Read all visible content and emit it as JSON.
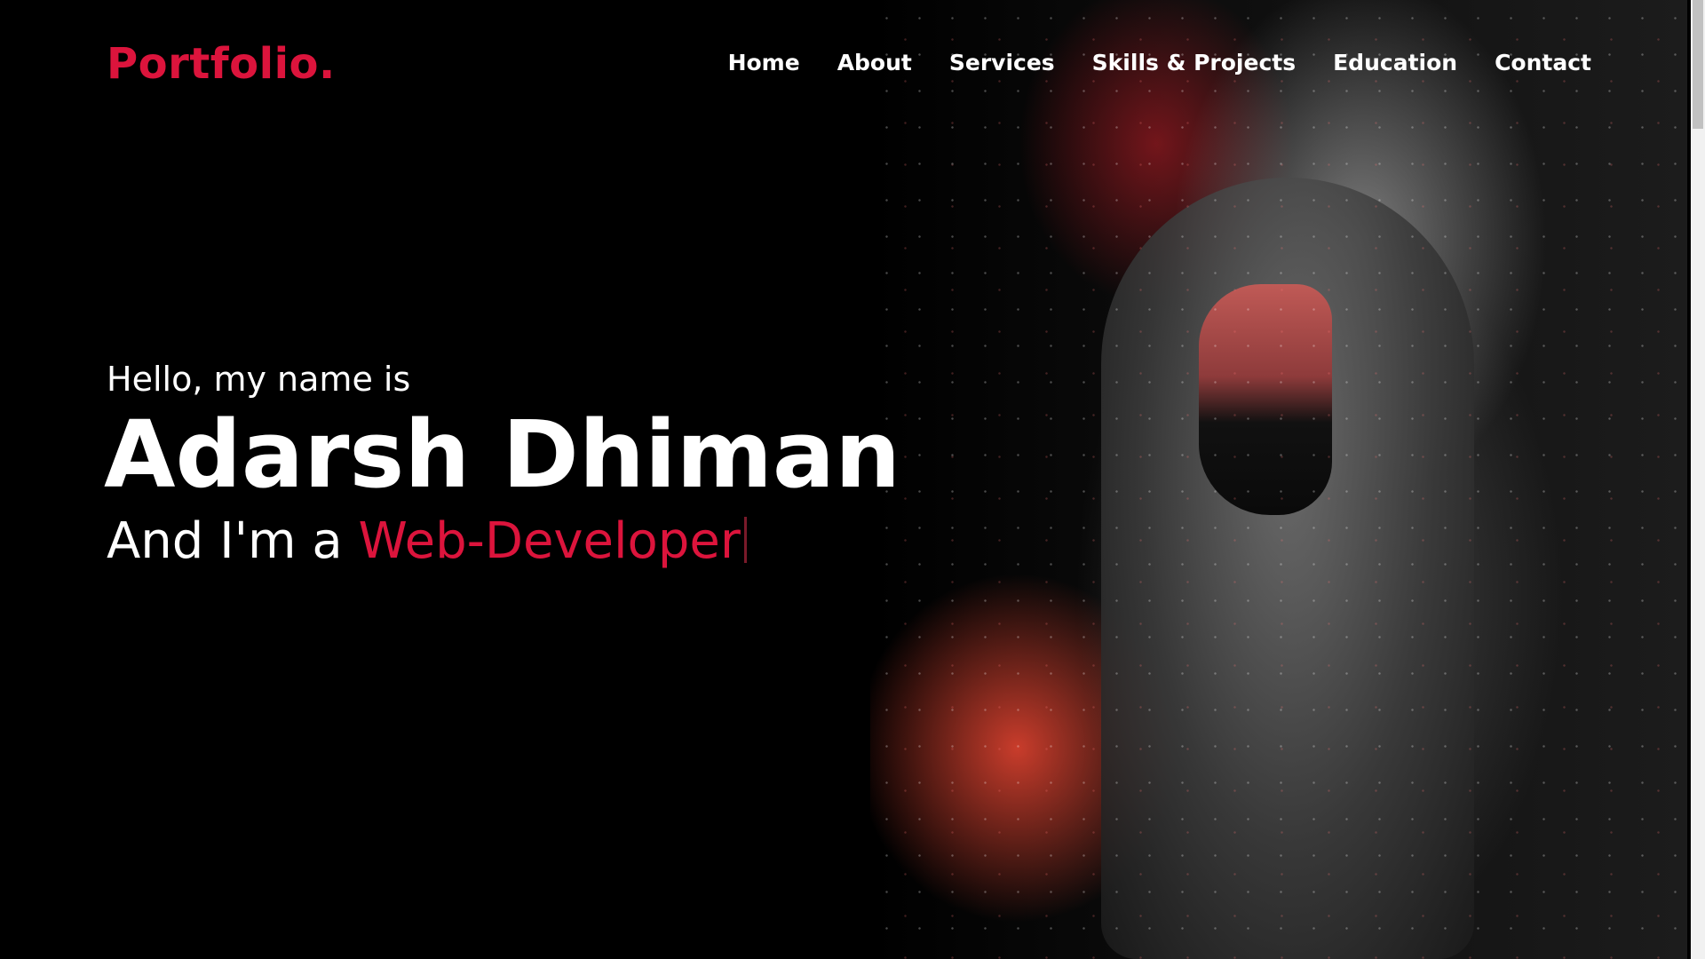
{
  "header": {
    "logo": "Portfolio."
  },
  "nav": {
    "items": [
      {
        "label": "Home"
      },
      {
        "label": "About"
      },
      {
        "label": "Services"
      },
      {
        "label": "Skills & Projects"
      },
      {
        "label": "Education"
      },
      {
        "label": "Contact"
      }
    ]
  },
  "hero": {
    "greeting": "Hello, my name is",
    "name": "Adarsh Dhiman",
    "role_prefix": "And I'm a ",
    "role": "Web-Developer"
  },
  "colors": {
    "accent": "#dc143c",
    "background": "#000000",
    "text": "#ffffff"
  }
}
